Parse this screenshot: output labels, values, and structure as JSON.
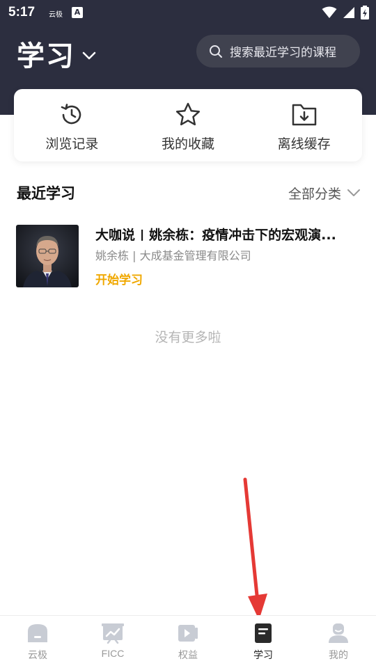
{
  "status_bar": {
    "time": "5:17",
    "app_badge_1": "云极",
    "app_badge_2": "A"
  },
  "header": {
    "title": "学习",
    "search_placeholder": "搜索最近学习的课程"
  },
  "quick_actions": [
    {
      "label": "浏览记录",
      "icon": "history-icon"
    },
    {
      "label": "我的收藏",
      "icon": "star-icon"
    },
    {
      "label": "离线缓存",
      "icon": "download-folder-icon"
    }
  ],
  "recent": {
    "title": "最近学习",
    "filter_label": "全部分类"
  },
  "courses": [
    {
      "title": "大咖说 | 姚余栋：疫情冲击下的宏观演...",
      "meta": "姚余栋 | 大成基金管理有限公司",
      "action": "开始学习"
    }
  ],
  "empty_hint": "没有更多啦",
  "tabs": [
    {
      "label": "云极",
      "icon": "home-icon",
      "active": false
    },
    {
      "label": "FICC",
      "icon": "chart-icon",
      "active": false
    },
    {
      "label": "权益",
      "icon": "video-icon",
      "active": false
    },
    {
      "label": "学习",
      "icon": "book-icon",
      "active": true
    },
    {
      "label": "我的",
      "icon": "user-icon",
      "active": false
    }
  ],
  "colors": {
    "header_bg": "#2c2e3f",
    "accent_orange": "#f0a800",
    "annotation_red": "#e53935"
  }
}
